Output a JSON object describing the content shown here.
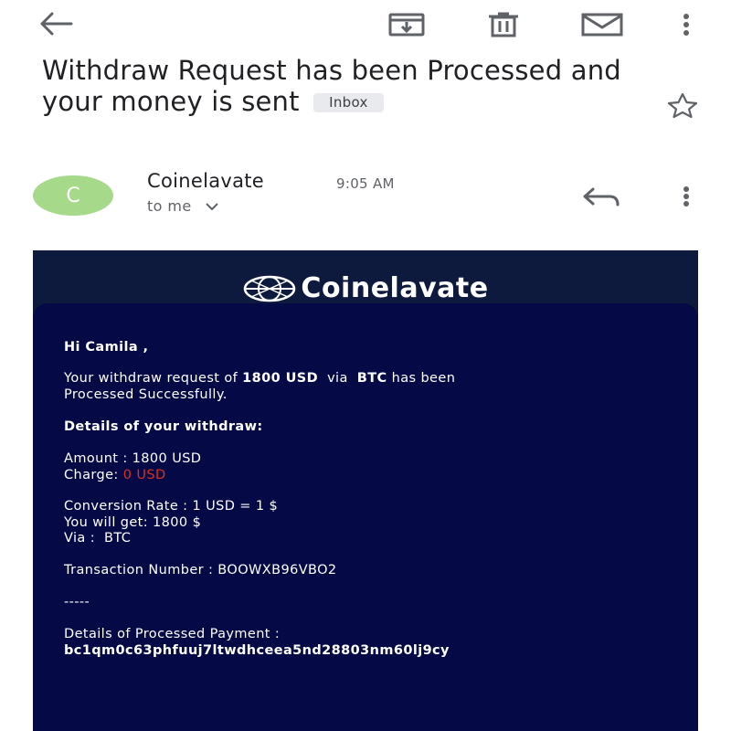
{
  "toolbar": {
    "back_icon": "arrow-left",
    "archive_icon": "archive",
    "delete_icon": "trash",
    "mark_unread_icon": "envelope",
    "more_icon": "more-vertical"
  },
  "email": {
    "subject": "Withdraw Request has been Processed and your money is sent",
    "label": "Inbox",
    "star_icon": "star-outline",
    "sender": {
      "avatar_letter": "C",
      "avatar_color": "#a7d98b",
      "name": "Coinelavate",
      "time": "9:05 AM",
      "recipient": "to me"
    }
  },
  "body": {
    "brand": "Coinelavate",
    "background_color": "#050946",
    "greeting": "Hi Camila ,",
    "intro": {
      "prefix": "Your withdraw request of",
      "amount": "1800 USD",
      "via_word": "via",
      "method": "BTC",
      "suffix": "has been",
      "line2": "Processed Successfully."
    },
    "details_heading": "Details of your withdraw:",
    "amount_line": "Amount : 1800 USD",
    "charge_label": "Charge:",
    "charge_value": "0 USD",
    "charge_color": "#d93025",
    "conversion_line": "Conversion Rate : 1 USD = 1 $",
    "receive_line": "You will get: 1800 $",
    "via_line": "Via :  BTC",
    "transaction_line": "Transaction Number : BOOWXB96VBO2",
    "separator": "-----",
    "payment_heading": "Details of Processed Payment :",
    "payment_address": "bc1qm0c63phfuuj7ltwdhceea5nd28803nm60lj9cy"
  }
}
